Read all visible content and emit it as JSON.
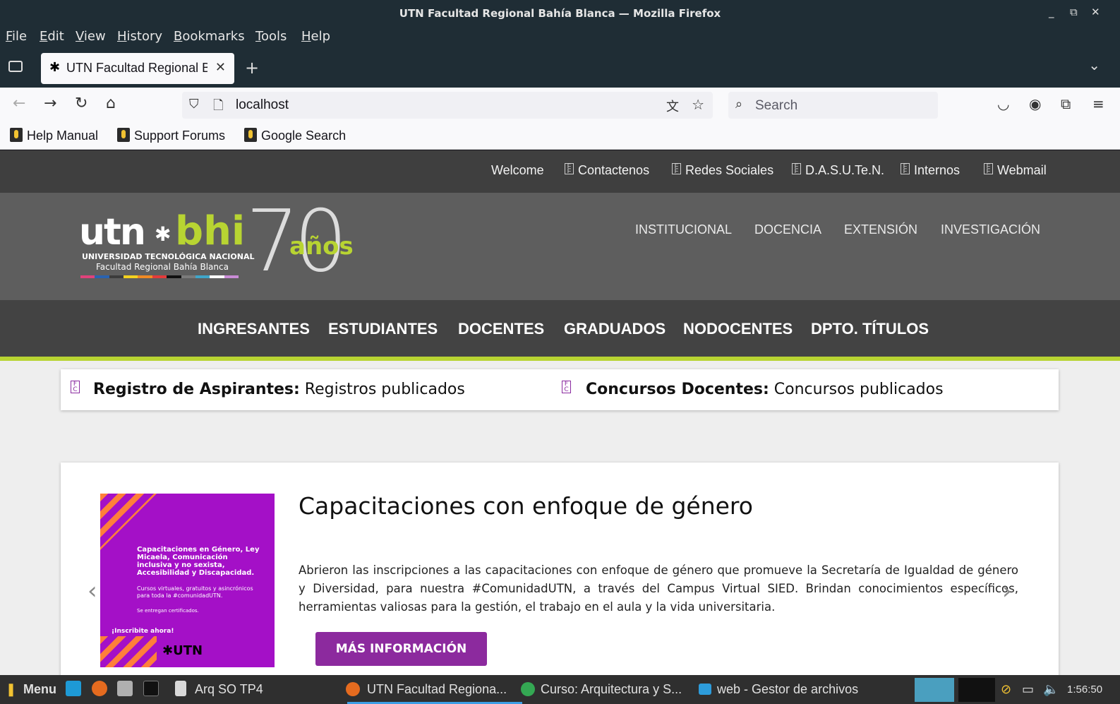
{
  "window": {
    "title": "UTN Facultad Regional Bahía Blanca — Mozilla Firefox",
    "controls": [
      "_",
      "⧉",
      "✕"
    ]
  },
  "menu": [
    "File",
    "Edit",
    "View",
    "History",
    "Bookmarks",
    "Tools",
    "Help"
  ],
  "tab": {
    "label": "UTN Facultad Regional Bahía Blanca",
    "favicon": "utn-asterisk-icon"
  },
  "navbar": {
    "url": "localhost",
    "search_placeholder": "Search"
  },
  "bookmarks": [
    "Help Manual",
    "Support Forums",
    "Google Search"
  ],
  "site": {
    "top_links": [
      "Welcome",
      "Contactenos",
      "Redes Sociales",
      "D.A.S.U.Te.N.",
      "Internos",
      "Webmail"
    ],
    "logo": {
      "utn": "utn",
      "bhi": "bhi",
      "subtitle1": "UNIVERSIDAD TECNOLÓGICA NACIONAL",
      "subtitle2": "Facultad Regional Bahía Blanca",
      "seventy": "70",
      "anos": "años",
      "stripe_colors": [
        "#e0427b",
        "#2a63b0",
        "#3c3c3c",
        "#f4d21f",
        "#f08a24",
        "#e33b3b",
        "#111111",
        "#7b7b7b",
        "#3fa6c9",
        "#ffffff",
        "#c98cd6"
      ]
    },
    "header_nav": [
      "INSTITUCIONAL",
      "DOCENCIA",
      "EXTENSIÓN",
      "INVESTIGACIÓN"
    ],
    "main_nav": [
      "INGRESANTES",
      "ESTUDIANTES",
      "DOCENTES",
      "GRADUADOS",
      "NODOCENTES",
      "DPTO. TÍTULOS"
    ],
    "notices": [
      {
        "bold": "Registro de Aspirantes:",
        "text": " Registros publicados"
      },
      {
        "bold": "Concursos Docentes:",
        "text": " Concursos publicados"
      }
    ],
    "feature": {
      "title": "Capacitaciones con enfoque de género",
      "body": "Abrieron las inscripciones a las capacitaciones con enfoque de género que promueve la Secretaría de Igualdad de género y Diversidad, para nuestra #ComunidadUTN, a través del Campus Virtual SIED. Brindan conocimientos específicos, herramientas valiosas para la gestión, el trabajo en el aula y la vida universitaria.",
      "button": "MÁS INFORMACIÓN",
      "promo": {
        "heading": "Capacitaciones en Género, Ley Micaela, Comunicación inclusiva y no sexista, Accesibilidad y Discapacidad.",
        "sub": "Cursos virtuales, gratuitos y asincrónicos para toda la #comunidadUTN.",
        "cert": "Se entregan certificados.",
        "cta": "¡Inscribite ahora!",
        "logo": "✱UTN"
      }
    },
    "colors": {
      "accent_green": "#b8d432",
      "purple": "#8c2a9e"
    }
  },
  "taskbar": {
    "menu_label": "Menu",
    "items": [
      "Arq SO TP4",
      "UTN Facultad Regiona...",
      "Curso: Arquitectura y S...",
      "web - Gestor de archivos"
    ],
    "clock": "1:56:50"
  }
}
